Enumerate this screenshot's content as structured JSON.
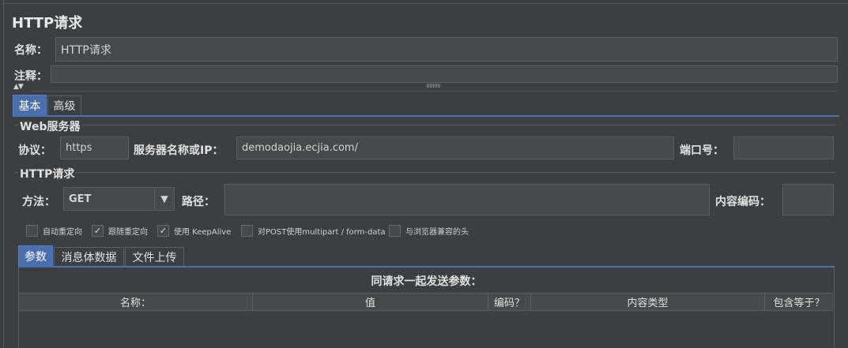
{
  "panel": {
    "title": "HTTP请求"
  },
  "name_row": {
    "label": "名称：",
    "value": "HTTP请求"
  },
  "comment_row": {
    "label": "注释：",
    "value": ""
  },
  "main_tabs": [
    {
      "label": "基本",
      "active": true
    },
    {
      "label": "高级",
      "active": false
    }
  ],
  "web_server": {
    "title": "Web服务器",
    "protocol_label": "协议：",
    "protocol_value": "https",
    "server_label": "服务器名称或IP：",
    "server_value": "demodaojia.ecjia.com/",
    "port_label": "端口号：",
    "port_value": ""
  },
  "http_request": {
    "title": "HTTP请求",
    "method_label": "方法：",
    "method_value": "GET",
    "path_label": "路径：",
    "path_value": "",
    "encoding_label": "内容编码：",
    "encoding_value": ""
  },
  "checkboxes": [
    {
      "label": "自动重定向",
      "checked": false
    },
    {
      "label": "跟随重定向",
      "checked": true
    },
    {
      "label": "使用 KeepAlive",
      "checked": true
    },
    {
      "label": "对POST使用multipart / form-data",
      "checked": false
    },
    {
      "label": "与浏览器兼容的头",
      "checked": false
    }
  ],
  "sub_tabs": [
    {
      "label": "参数",
      "active": true
    },
    {
      "label": "消息体数据",
      "active": false
    },
    {
      "label": "文件上传",
      "active": false
    }
  ],
  "params": {
    "caption": "同请求一起发送参数：",
    "columns": [
      "名称：",
      "值",
      "编码？",
      "内容类型",
      "包含等于？"
    ]
  },
  "colors": {
    "background": "#3c3f41",
    "field": "#45494a",
    "accent": "#4b6eaf"
  },
  "icons": {
    "collapse": "triangle-up-down-icon",
    "splitter": "splitter-grip-icon",
    "dropdown": "triangle-down-icon"
  }
}
